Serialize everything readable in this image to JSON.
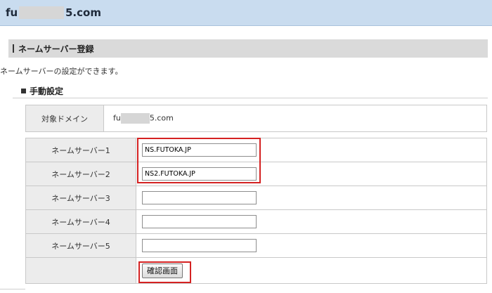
{
  "header": {
    "domain_prefix": "fu",
    "domain_suffix": "5.com"
  },
  "section": {
    "title": "ネームサーバー登録"
  },
  "description": "ネームサーバーの設定ができます。",
  "subsection": {
    "title": "手動設定"
  },
  "target_domain": {
    "label": "対象ドメイン",
    "prefix": "fu",
    "suffix": "5.com"
  },
  "nameservers": [
    {
      "label": "ネームサーバー1",
      "value": "NS.FUTOKA.JP"
    },
    {
      "label": "ネームサーバー2",
      "value": "NS2.FUTOKA.JP"
    },
    {
      "label": "ネームサーバー3",
      "value": ""
    },
    {
      "label": "ネームサーバー4",
      "value": ""
    },
    {
      "label": "ネームサーバー5",
      "value": ""
    }
  ],
  "confirm_button": "確認画面",
  "colors": {
    "header_bg": "#c9dcef",
    "section_bg": "#dadada",
    "highlight": "#d42222"
  }
}
